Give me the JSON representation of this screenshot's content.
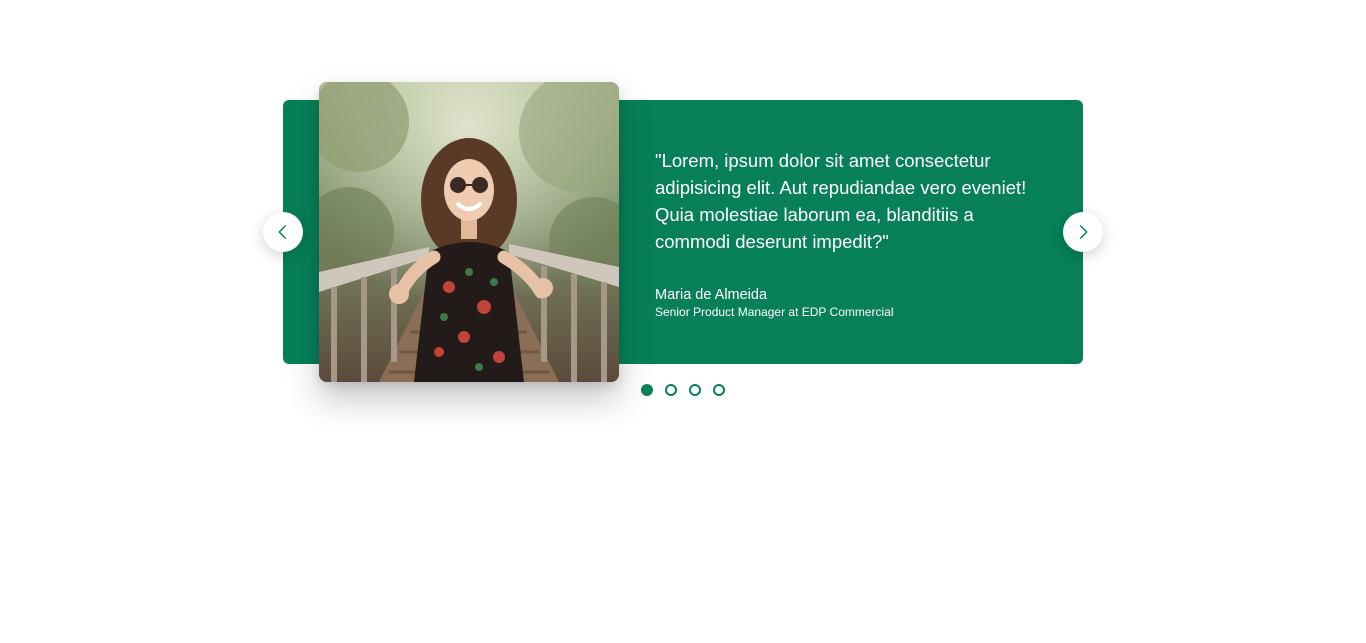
{
  "testimonial": {
    "quote": "\"Lorem, ipsum dolor sit amet consectetur adipisicing elit. Aut repudiandae vero eveniet! Quia molestiae laborum ea, blanditiis a commodi deserunt impedit?\"",
    "author_name": "Maria de Almeida",
    "author_role": "Senior Product Manager at EDP Commercial"
  },
  "carousel": {
    "slide_count": 4,
    "active_slide": 1,
    "prev_icon": "chevron-left-icon",
    "next_icon": "chevron-right-icon"
  },
  "colors": {
    "accent": "#07805a",
    "text_on_accent": "#ffffff",
    "background": "#ffffff"
  }
}
